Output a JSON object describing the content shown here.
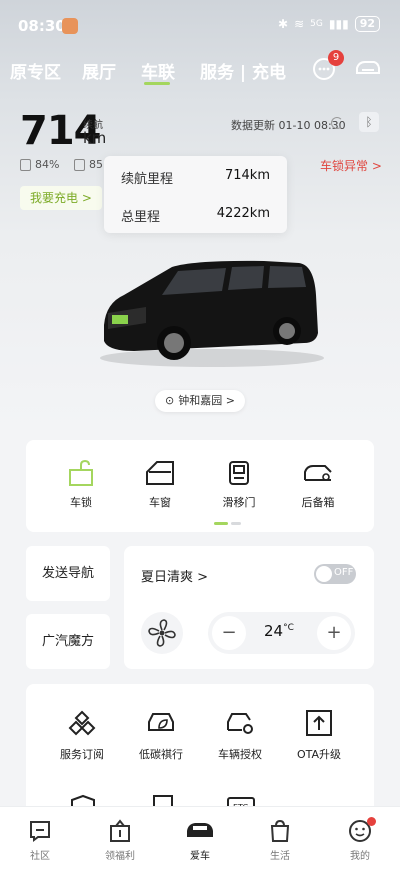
{
  "status_bar": {
    "time": "08:30",
    "battery": "92",
    "signal": "5G"
  },
  "top_nav": {
    "tabs": [
      "原专区",
      "展厅",
      "车联",
      "服务 | 充电"
    ],
    "active_tab": "车联",
    "message_badge": "9"
  },
  "vehicle": {
    "range_value": "714",
    "range_label": "续航",
    "range_unit": "km",
    "update_text": "数据更新 01-10 08:30",
    "battery_percent": "84%",
    "stat2": "85",
    "lock_warning": "车锁异常 >",
    "charge_button": "我要充电 >",
    "location": "钟和嘉园 >"
  },
  "popup": {
    "rows": [
      {
        "label": "续航里程",
        "value": "714km"
      },
      {
        "label": "总里程",
        "value": "4222km"
      }
    ]
  },
  "controls": [
    {
      "label": "车锁",
      "icon": "lock-icon"
    },
    {
      "label": "车窗",
      "icon": "window-icon"
    },
    {
      "label": "滑移门",
      "icon": "sliding-door-icon"
    },
    {
      "label": "后备箱",
      "icon": "trunk-icon"
    }
  ],
  "side_buttons": [
    "发送导航",
    "广汽魔方"
  ],
  "climate": {
    "mode": "夏日清爽 >",
    "toggle": "OFF",
    "temperature": "24",
    "temp_unit": "°C"
  },
  "services": [
    {
      "label": "服务订阅",
      "icon": "subscription-icon"
    },
    {
      "label": "低碳祺行",
      "icon": "low-carbon-icon"
    },
    {
      "label": "车辆授权",
      "icon": "authorization-icon"
    },
    {
      "label": "OTA升级",
      "icon": "ota-icon"
    }
  ],
  "bottom_nav": [
    {
      "label": "社区"
    },
    {
      "label": "领福利"
    },
    {
      "label": "爱车"
    },
    {
      "label": "生活"
    },
    {
      "label": "我的"
    }
  ],
  "colors": {
    "accent": "#a4d65e",
    "warning": "#e0463f",
    "badge": "#e5413d"
  }
}
